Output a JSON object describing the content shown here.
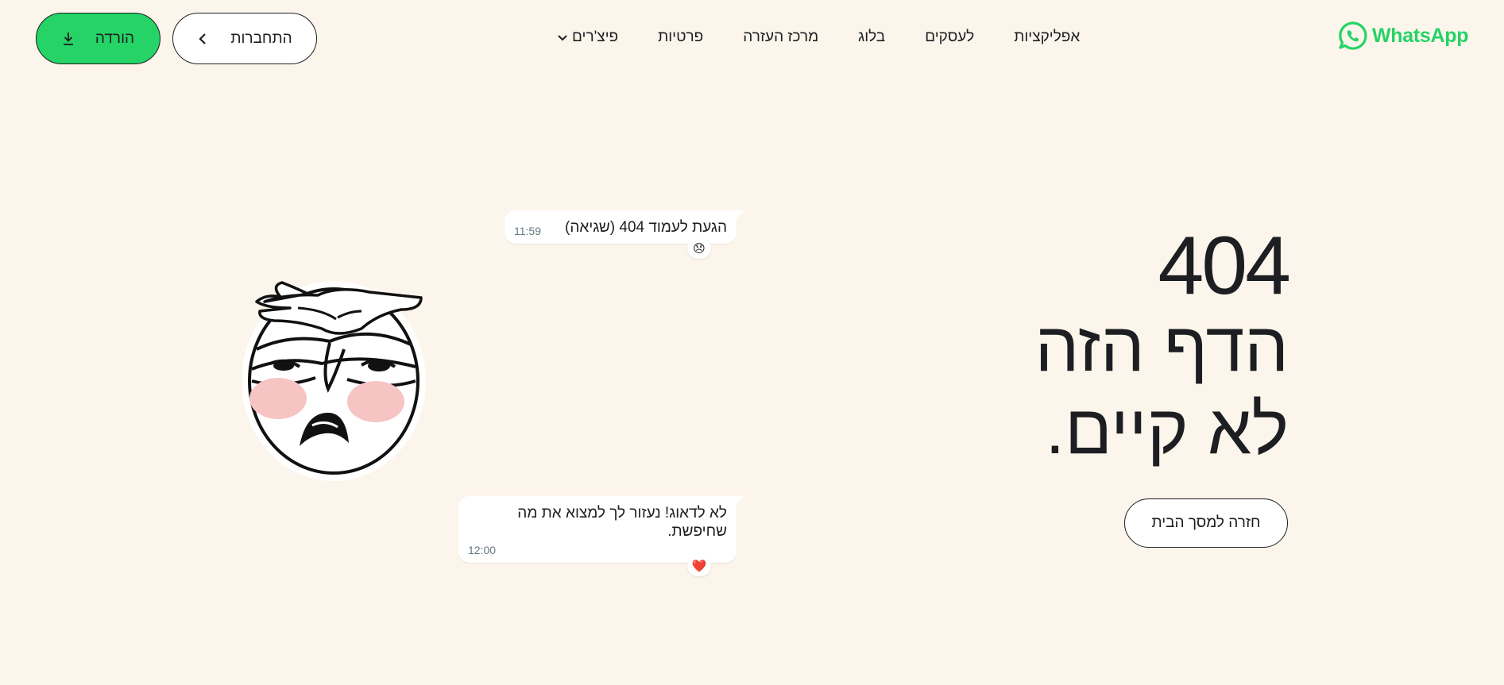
{
  "brand": {
    "name": "WhatsApp",
    "color": "#25d366",
    "icon": "whatsapp-logo-icon"
  },
  "nav": {
    "items": [
      {
        "label": "פיצ'רים",
        "has_dropdown": true
      },
      {
        "label": "פרטיות"
      },
      {
        "label": "מרכז העזרה"
      },
      {
        "label": "בלוג"
      },
      {
        "label": "לעסקים"
      },
      {
        "label": "אפליקציות"
      }
    ]
  },
  "actions": {
    "login_label": "התחברות",
    "download_label": "הורדה"
  },
  "hero": {
    "code": "404",
    "line1": "הדף הזה",
    "line2": "לא קיים.",
    "home_button": "חזרה למסך הבית"
  },
  "chat": {
    "message1": {
      "text": "הגעת לעמוד 404 (שגיאה)",
      "time": "11:59",
      "reaction": "😞"
    },
    "message2": {
      "text": "לא לדאוג! נעזור לך למצוא את מה שחיפשת.",
      "time": "12:00",
      "reaction": "❤️"
    }
  },
  "sticker": {
    "icon": "facepalm-sticker-icon"
  }
}
